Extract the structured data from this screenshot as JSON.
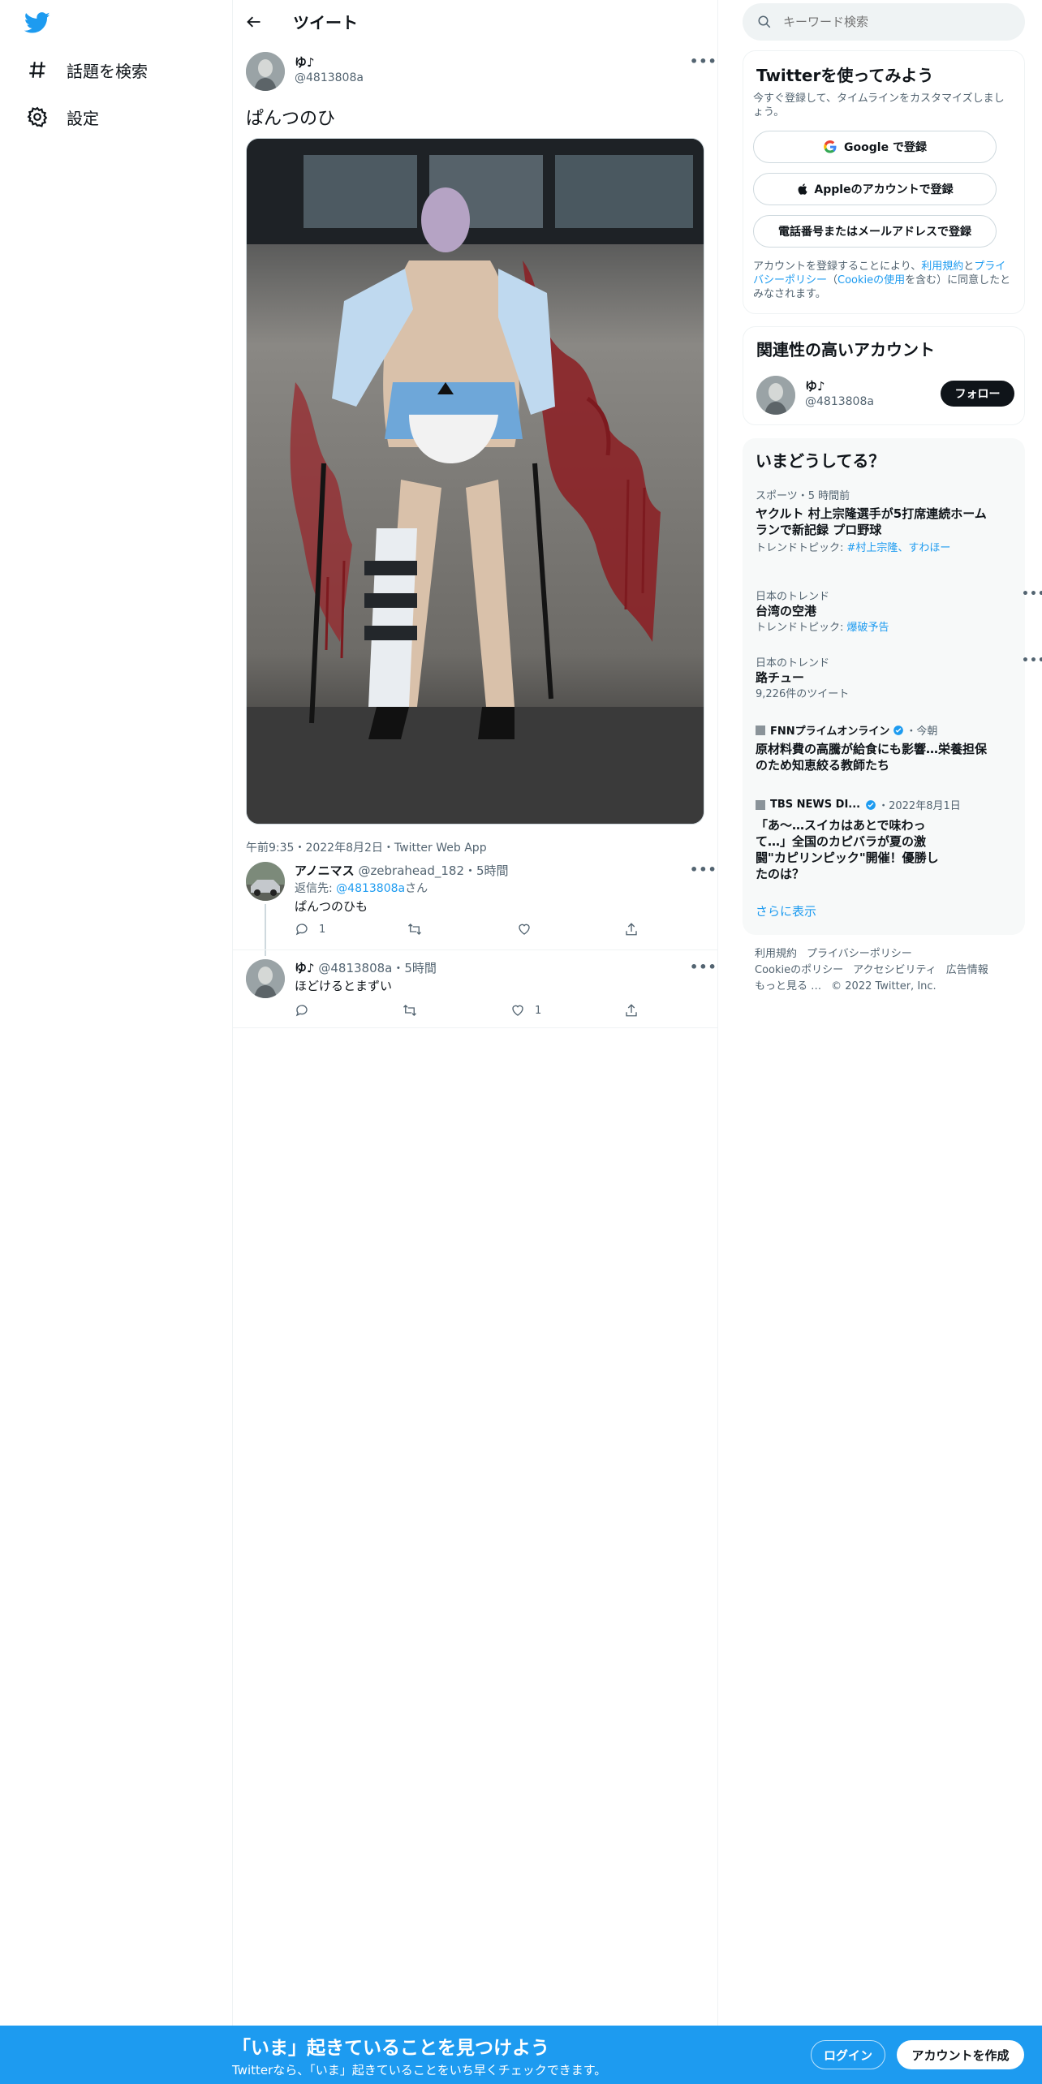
{
  "nav": {
    "explore_label": "話題を検索",
    "settings_label": "設定"
  },
  "header": {
    "title": "ツイート"
  },
  "tweet": {
    "author_name": "ゆ♪",
    "author_handle": "@4813808a",
    "text": "ぱんつのひ",
    "meta": "午前9:35・2022年8月2日・Twitter Web App"
  },
  "replies": [
    {
      "name": "アノニマス",
      "handle": "@zebrahead_182",
      "time": "・5時間",
      "reply_to_label": "返信先:",
      "reply_to_handle": "@4813808a",
      "reply_to_suffix": "さん",
      "text": "ぱんつのひも",
      "reply_count": "1",
      "retweet_count": "",
      "like_count": ""
    },
    {
      "name": "ゆ♪",
      "handle": "@4813808a",
      "time": "・5時間",
      "text": "ほどけるとまずい",
      "reply_count": "",
      "retweet_count": "",
      "like_count": "1"
    }
  ],
  "search": {
    "placeholder": "キーワード検索"
  },
  "signup_card": {
    "title": "Twitterを使ってみよう",
    "subtitle": "今すぐ登録して、タイムラインをカスタマイズしましょう。",
    "google_label": "Google で登録",
    "apple_label": "Appleのアカウントで登録",
    "phone_label": "電話番号またはメールアドレスで登録",
    "legal_prefix": "アカウントを登録することにより、",
    "legal_terms": "利用規約",
    "legal_and": "と",
    "legal_privacy": "プライバシーポリシー",
    "legal_open": "（",
    "legal_cookie": "Cookieの使用",
    "legal_suffix": "を含む）に同意したとみなされます。"
  },
  "related": {
    "title": "関連性の高いアカウント",
    "name": "ゆ♪",
    "handle": "@4813808a",
    "follow_label": "フォロー"
  },
  "trends": {
    "title": "いまどうしてる？",
    "items": [
      {
        "category": "スポーツ・5 時間前",
        "title": "ヤクルト 村上宗隆選手が5打席連続ホームランで新記録 プロ野球",
        "sub_prefix": "トレンドトピック: ",
        "sub_link": "#村上宗隆、すわほー"
      },
      {
        "category": "日本のトレンド",
        "title": "台湾の空港",
        "sub_prefix": "トレンドトピック: ",
        "sub_link": "爆破予告"
      },
      {
        "category": "日本のトレンド",
        "title": "路チュー",
        "sub_prefix": "9,226件のツイート",
        "sub_link": ""
      },
      {
        "category_source": "FNNプライムオンライン",
        "category_time": "・今朝",
        "title": "原材料費の高騰が給食にも影響…栄養担保のため知恵絞る教師たち"
      },
      {
        "category_source": "TBS NEWS DI...",
        "category_time": "・2022年8月1日",
        "title": "「あ～…スイカはあとで味わって…」全国のカピバラが夏の激闘\"カピリンピック\"開催！優勝したのは？"
      }
    ],
    "show_more": "さらに表示",
    "more_icon": "ellipsis-icon"
  },
  "footer": {
    "links": [
      "利用規約",
      "プライバシーポリシー",
      "Cookieのポリシー",
      "アクセシビリティ",
      "広告情報",
      "もっと見る …",
      "© 2022 Twitter, Inc."
    ]
  },
  "bottom_bar": {
    "title": "「いま」起きていることを見つけよう",
    "subtitle": "Twitterなら、「いま」起きていることをいち早くチェックできます。",
    "login_label": "ログイン",
    "signup_label": "アカウントを作成"
  },
  "colors": {
    "brand": "#1d9bf0",
    "text": "#0f1419",
    "muted": "#536471",
    "border": "#eff3f4",
    "trends_bg": "#f7f9f9"
  }
}
